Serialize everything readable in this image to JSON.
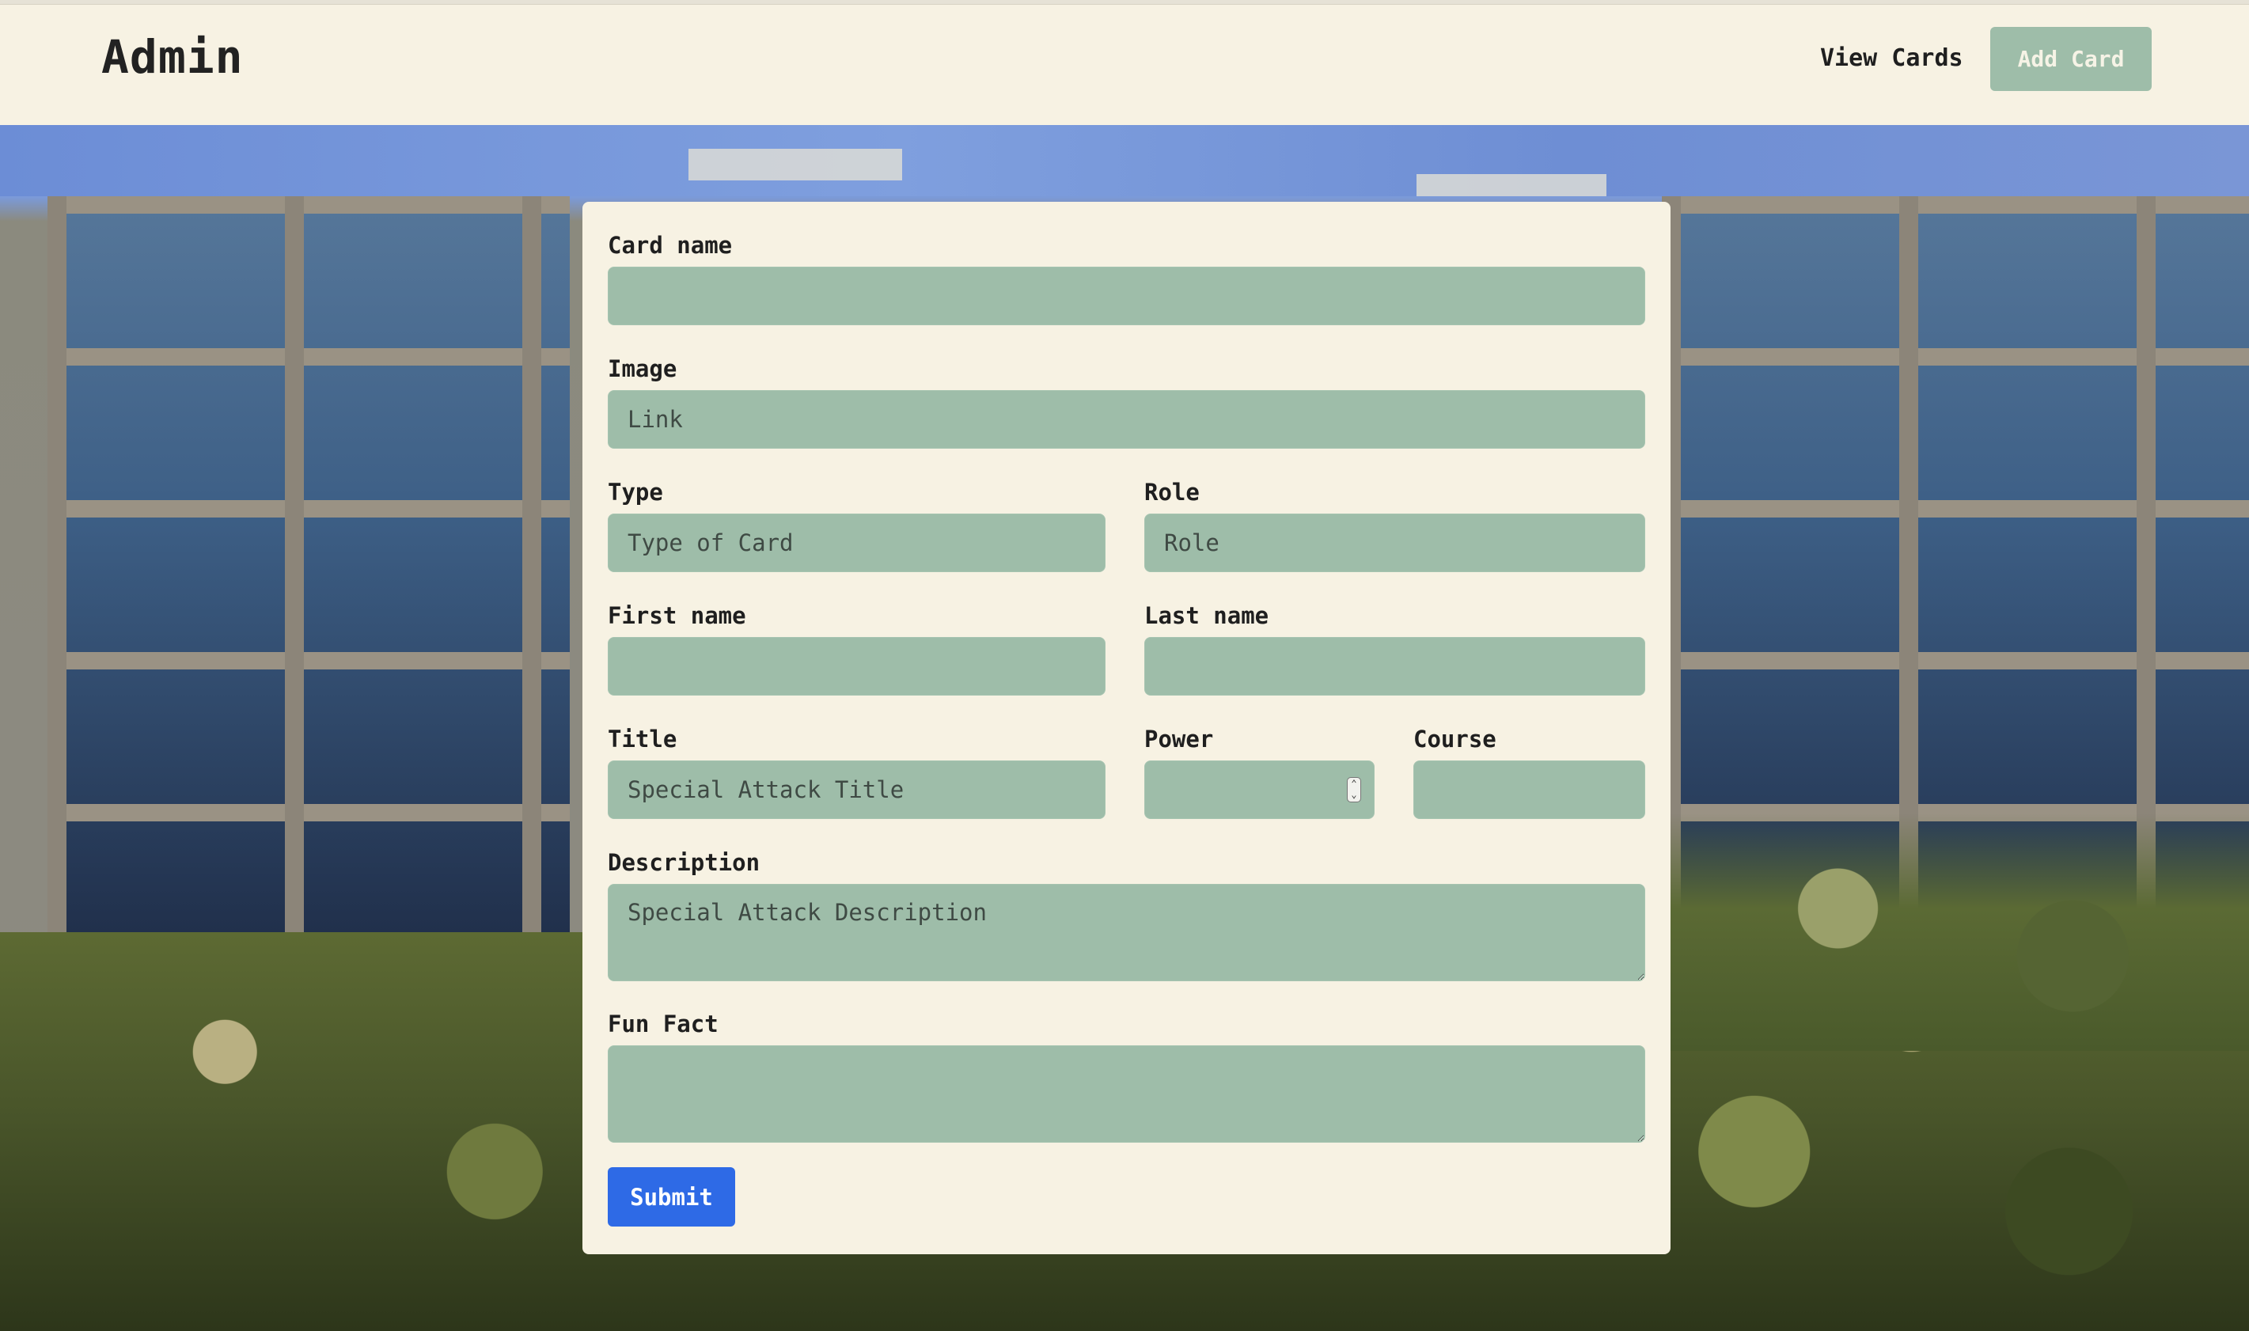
{
  "header": {
    "brand": "Admin",
    "nav": {
      "view_cards": "View Cards",
      "add_card": "Add Card"
    }
  },
  "form": {
    "card_name": {
      "label": "Card name",
      "placeholder": ""
    },
    "image": {
      "label": "Image",
      "placeholder": "Link"
    },
    "type": {
      "label": "Type",
      "placeholder": "Type of Card"
    },
    "role": {
      "label": "Role",
      "placeholder": "Role"
    },
    "first_name": {
      "label": "First name",
      "placeholder": ""
    },
    "last_name": {
      "label": "Last name",
      "placeholder": ""
    },
    "title": {
      "label": "Title",
      "placeholder": "Special Attack Title"
    },
    "power": {
      "label": "Power",
      "placeholder": ""
    },
    "course": {
      "label": "Course",
      "placeholder": ""
    },
    "description": {
      "label": "Description",
      "placeholder": "Special Attack Description"
    },
    "fun_fact": {
      "label": "Fun Fact",
      "placeholder": ""
    },
    "submit": "Submit"
  },
  "colors": {
    "page_bg": "#f7f2e3",
    "field_bg": "#9ebda9",
    "primary_button": "#2e6ae6",
    "secondary_button": "#9ebda9"
  }
}
